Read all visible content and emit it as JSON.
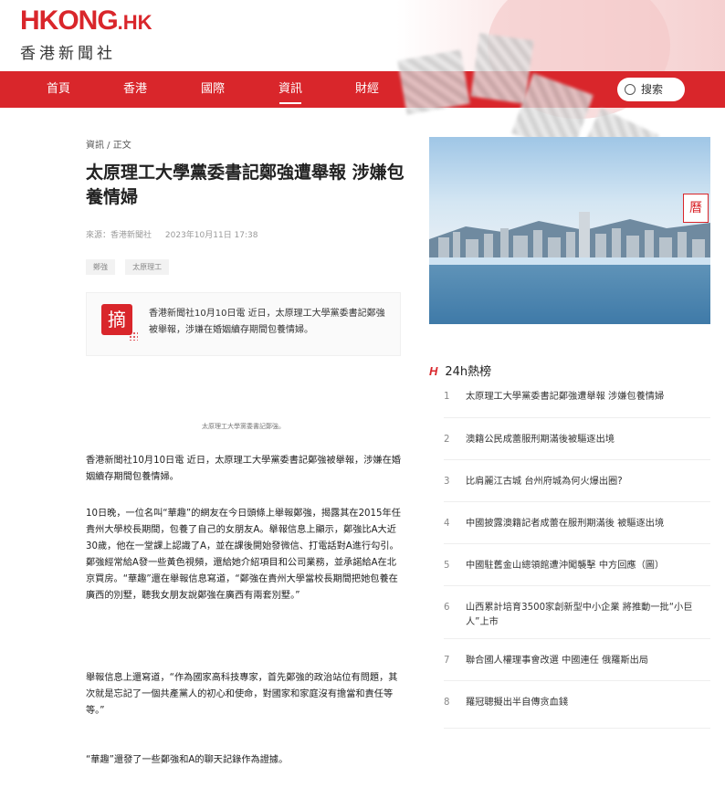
{
  "brand": {
    "logo": "HKONG",
    "logo_suffix": ".HK",
    "subtitle": "香港新聞社"
  },
  "nav": {
    "items": [
      "首頁",
      "香港",
      "國際",
      "資訊",
      "財經"
    ],
    "active_index": 3,
    "search_label": "搜索"
  },
  "article": {
    "breadcrumb": "資訊 / 正文",
    "title": "太原理工大學黨委書記鄭強遭舉報 涉嫌包養情婦",
    "source": "來源：香港新聞社",
    "datetime": "2023年10月11日 17:38",
    "tags": [
      "鄭強",
      "太原理工"
    ],
    "summary_badge": "摘",
    "summary": "香港新聞社10月10日電 近日，太原理工大學黨委書記鄭強被舉報，涉嫌在婚姻續存期間包養情婦。",
    "image_caption": "太原理工大學黨委書記鄭強。",
    "paragraphs": [
      "香港新聞社10月10日電 近日，太原理工大學黨委書記鄭強被舉報，涉嫌在婚姻續存期間包養情婦。",
      "10日晚，一位名叫“華趣”的網友在今日頭條上舉報鄭強，揭露其在2015年任貴州大學校長期間，包養了自己的女朋友A。舉報信息上顯示，鄭強比A大近30歲，他在一堂課上認識了A，並在課後開始發微信、打電話對A進行勾引。鄭強經常給A發一些黃色視頻，還給她介紹項目和公司業務，並承諾給A在北京買房。“華趣”還在舉報信息寫道，“鄭強在貴州大學當校長期間把她包養在廣西的別墅，聽我女朋友說鄭強在廣西有兩套別墅。”",
      "舉報信息上還寫道，“作為國家高科技專家，首先鄭強的政治站位有問題，其次就是忘記了一個共產黨人的初心和使命，對國家和家庭沒有擔當和責任等等。”",
      "“華趣”還發了一些鄭強和A的聊天記錄作為證據。"
    ]
  },
  "sidebar": {
    "calendar_label": "曆",
    "hot_prefix": "H",
    "hot_title": "24h熱榜",
    "hot_items": [
      {
        "num": "1",
        "text": "太原理工大學黨委書記鄭強遭舉報 涉嫌包養情婦"
      },
      {
        "num": "2",
        "text": "澳籍公民成蕾服刑期滿後被驅逐出境"
      },
      {
        "num": "3",
        "text": "比肩麗江古城 台州府城為何火爆出圈?"
      },
      {
        "num": "4",
        "text": "中國披露澳籍記者成蕾在服刑期滿後 被驅逐出境"
      },
      {
        "num": "5",
        "text": "中國駐舊金山總領館遭沖闖襲擊 中方回應（圖）"
      },
      {
        "num": "6",
        "text": "山西累計培育3500家創新型中小企業 將推動一批“小巨人”上市"
      },
      {
        "num": "7",
        "text": "聯合國人權理事會改選 中國連任 俄羅斯出局"
      },
      {
        "num": "8",
        "text": "羅冠聰擬出半自傳贪血錢"
      }
    ]
  },
  "colors": {
    "brand_red": "#d9262b",
    "text_dark": "#222222",
    "muted": "#999999"
  }
}
